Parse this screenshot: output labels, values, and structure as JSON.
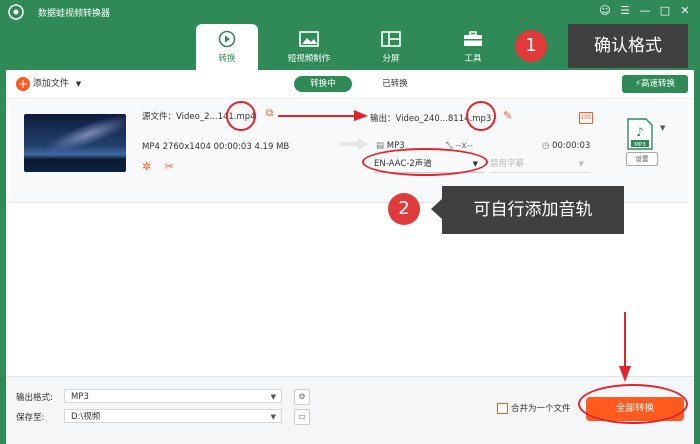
{
  "app": {
    "title": "数据蛙视频转换器"
  },
  "window": {
    "buttons": [
      "☺",
      "☰",
      "—",
      "□",
      "✕"
    ]
  },
  "tabs": [
    {
      "label": "转换",
      "icon": "convert-icon",
      "active": true
    },
    {
      "label": "短视频制作",
      "icon": "short-video-icon",
      "active": false
    },
    {
      "label": "分屏",
      "icon": "split-screen-icon",
      "active": false
    },
    {
      "label": "工具",
      "icon": "toolbox-icon",
      "active": false
    }
  ],
  "toolbar": {
    "add_file": "添加文件",
    "seg_converting": "转换中",
    "seg_converted": "已转换",
    "fast_convert": "高速转换"
  },
  "file": {
    "source_name": "源文件：Video_2...141.mp4",
    "source_meta": "MP4   2760x1404   00:00:03   4.19 MB",
    "output_name": "输出：Video_240...8114.mp3",
    "output_format": "MP3",
    "output_res": "--x--",
    "output_duration": "00:00:03",
    "audio_track": "EN-AAC-2声道",
    "subtitle": "禁用字幕",
    "format_badge": "MP3",
    "settings": "设置"
  },
  "footer": {
    "output_format_label": "输出格式:",
    "output_format_value": "MP3",
    "save_to_label": "保存至:",
    "save_to_value": "D:\\视频",
    "merge_label": "合并为一个文件",
    "convert_all": "全部转换"
  },
  "annotations": {
    "step1_num": "1",
    "step1_text": "确认格式",
    "step2_num": "2",
    "step2_text": "可自行添加音轨"
  },
  "colors": {
    "brand": "#2f8a57",
    "accent": "#ff5a1f",
    "annotation": "#e0252a"
  }
}
